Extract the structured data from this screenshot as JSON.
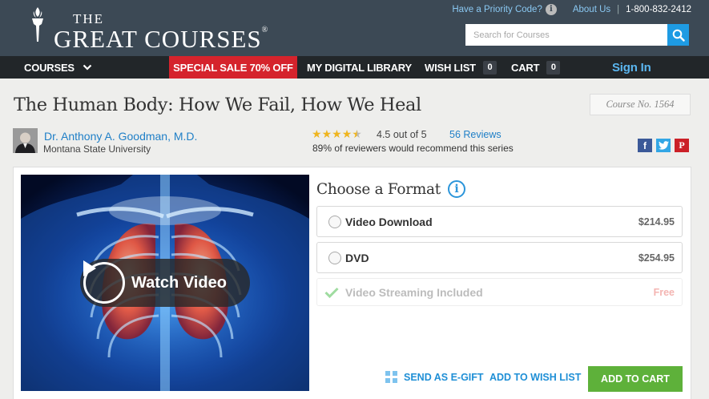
{
  "header": {
    "logo_the": "THE",
    "logo_great_courses": "GREAT COURSES",
    "priority_code": "Have a Priority Code?",
    "about_us": "About Us",
    "phone": "1-800-832-2412",
    "search_placeholder": "Search for Courses"
  },
  "nav": {
    "courses": "COURSES",
    "sale": "SPECIAL SALE 70% OFF",
    "library": "MY DIGITAL LIBRARY",
    "wish_list": "WISH LIST",
    "wish_count": "0",
    "cart": "CART",
    "cart_count": "0",
    "sign_in": "Sign In"
  },
  "course": {
    "title": "The Human Body: How We Fail, How We Heal",
    "number": "Course No. 1564",
    "professor": "Dr. Anthony A. Goodman, M.D.",
    "university": "Montana State University",
    "rating": 4.5,
    "rating_text": "4.5 out of 5",
    "reviews": "56 Reviews",
    "recommend": "89% of reviewers would recommend this series"
  },
  "video": {
    "watch_label": "Watch Video"
  },
  "format": {
    "heading": "Choose a Format",
    "options": [
      {
        "label": "Video Download",
        "price": "$214.95"
      },
      {
        "label": "DVD",
        "price": "$254.95"
      },
      {
        "label": "Video Streaming Included",
        "price": "Free"
      }
    ]
  },
  "actions": {
    "egift": "SEND AS E-GIFT",
    "wishlist": "ADD TO WISH LIST",
    "add_to_cart": "ADD TO CART"
  },
  "colors": {
    "header_bg": "#3c4955",
    "nav_bg": "#222629",
    "sale_red": "#d5232c",
    "link_blue": "#1f7fc7",
    "cart_green": "#5eb13a",
    "star_gold": "#efb51f"
  },
  "icons": {
    "search": "search-icon",
    "info": "info-icon",
    "chevron": "chevron-down-icon",
    "play": "play-icon",
    "check": "check-icon",
    "gift": "gift-icon",
    "facebook": "facebook-icon",
    "twitter": "twitter-icon",
    "pinterest": "pinterest-icon"
  }
}
